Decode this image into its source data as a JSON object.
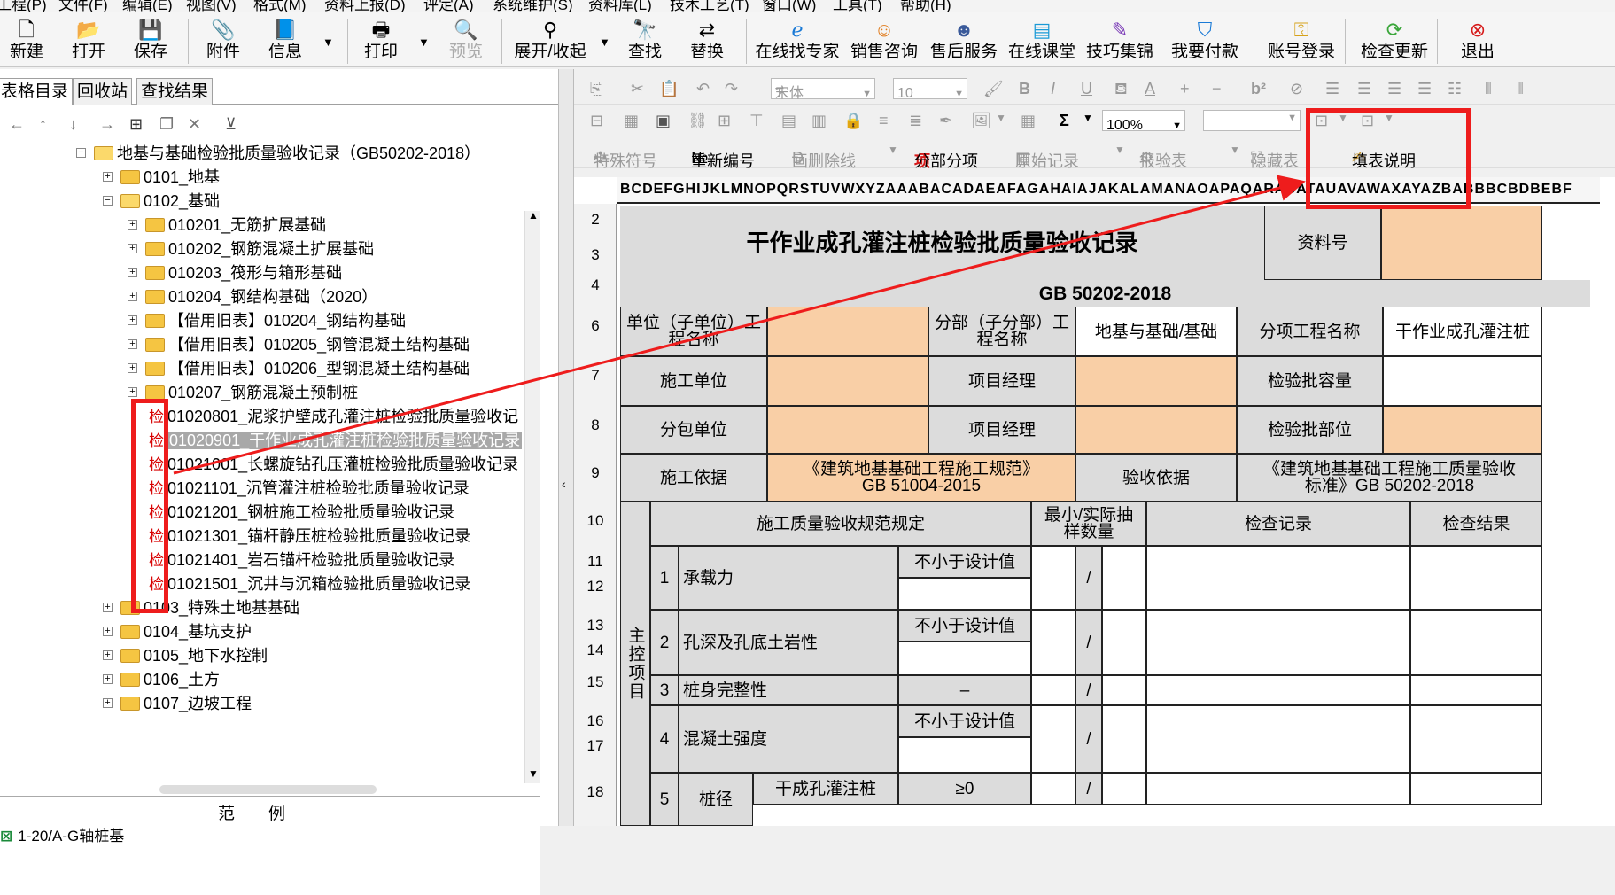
{
  "menu": [
    "工程(P)",
    "文件(F)",
    "编辑(E)",
    "视图(V)",
    "格式(M)",
    "资料上报(D)",
    "评定(A)",
    "系统维护(S)",
    "资料库(L)",
    "技术工艺(T)",
    "窗口(W)",
    "工具(T)",
    "帮助(H)"
  ],
  "toolbar": {
    "new": "新建",
    "open": "打开",
    "save": "保存",
    "attach": "附件",
    "info": "信息",
    "print": "打印",
    "preview": "预览",
    "expand": "展开/收起",
    "find": "查找",
    "replace": "替换",
    "expert": "在线找专家",
    "sales": "销售咨询",
    "service": "售后服务",
    "class": "在线课堂",
    "tips": "技巧集锦",
    "pay": "我要付款",
    "login": "账号登录",
    "update": "检查更新",
    "exit": "退出"
  },
  "tabs": [
    "表格目录",
    "回收站",
    "查找结果"
  ],
  "tree": {
    "root": "地基与基础检验批质量验收记录（GB50202-2018）",
    "n0101": "0101_地基",
    "n0102": "0102_基础",
    "children": [
      "010201_无筋扩展基础",
      "010202_钢筋混凝土扩展基础",
      "010203_筏形与箱形基础",
      "010204_钢结构基础（2020）",
      "【借用旧表】010204_钢结构基础",
      "【借用旧表】010205_钢管混凝土结构基础",
      "【借用旧表】010206_型钢混凝土结构基础",
      "010207_钢筋混凝土预制桩"
    ],
    "check_label": "检",
    "records": [
      "01020801_泥浆护壁成孔灌注桩检验批质量验收记",
      "01020901_干作业成孔灌注桩检验批质量验收记录",
      "01021001_长螺旋钻孔压灌桩检验批质量验收记录",
      "01021101_沉管灌注桩检验批质量验收记录",
      "01021201_钢桩施工检验批质量验收记录",
      "01021301_锚杆静压桩检验批质量验收记录",
      "01021401_岩石锚杆检验批质量验收记录",
      "01021501_沉井与沉箱检验批质量验收记录"
    ],
    "after": [
      "0103_特殊土地基基础",
      "0104_基坑支护",
      "0105_地下水控制",
      "0106_土方",
      "0107_边坡工程"
    ]
  },
  "legend": {
    "title": "范　　例",
    "item": "1-20/A-G轴桩基"
  },
  "editor": {
    "font": "宋体",
    "size": "10",
    "zoom": "100%",
    "row3_items": [
      "特殊符号",
      "重新编号",
      "画删除线",
      "分部分项",
      "原始记录",
      "报验表",
      "隐藏表",
      "填表说明"
    ],
    "col_letters": "BCDEFGHIJKLMNOPQRSTUVWXYZAAABACADAEAFAGAHAIAJAKALAMANAOAPAQARASATAUAVAWAXAYAZBABBBCBDBEBF"
  },
  "form": {
    "title": "干作业成孔灌注桩检验批质量验收记录",
    "doc_no_label": "资料号",
    "standard": "GB 50202-2018",
    "unit_label": "单位（子单位）工程名称",
    "subdiv_label": "分部（子分部）工程名称",
    "subdiv_value": "地基与基础/基础",
    "item_label": "分项工程名称",
    "item_value": "干作业成孔灌注桩",
    "contractor_label": "施工单位",
    "pm_label": "项目经理",
    "capacity_label": "检验批容量",
    "subcontractor_label": "分包单位",
    "pm2_label": "项目经理",
    "part_label": "检验批部位",
    "basis_label": "施工依据",
    "basis_value": "《建筑地基基础工程施工规范》GB 51004-2015",
    "accept_label": "验收依据",
    "accept_value": "《建筑地基基础工程施工质量验收标准》GB 50202-2018",
    "spec_header": "施工质量验收规范规定",
    "sample_header": "最小/实际抽样数量",
    "record_header": "检查记录",
    "result_header": "检查结果",
    "main_label": "主控项目",
    "items": [
      {
        "no": "1",
        "name": "承载力",
        "req": "不小于设计值"
      },
      {
        "no": "2",
        "name": "孔深及孔底土岩性",
        "req": "不小于设计值"
      },
      {
        "no": "3",
        "name": "桩身完整性",
        "req": "–"
      },
      {
        "no": "4",
        "name": "混凝土强度",
        "req": "不小于设计值"
      },
      {
        "no": "5",
        "name": "桩径",
        "sub": "干成孔灌注桩",
        "req": "≥0"
      }
    ],
    "slash": "/"
  },
  "rows": [
    "2",
    "3",
    "4",
    "6",
    "7",
    "8",
    "9",
    "10",
    "11",
    "12",
    "13",
    "14",
    "15",
    "16",
    "17",
    "18"
  ]
}
